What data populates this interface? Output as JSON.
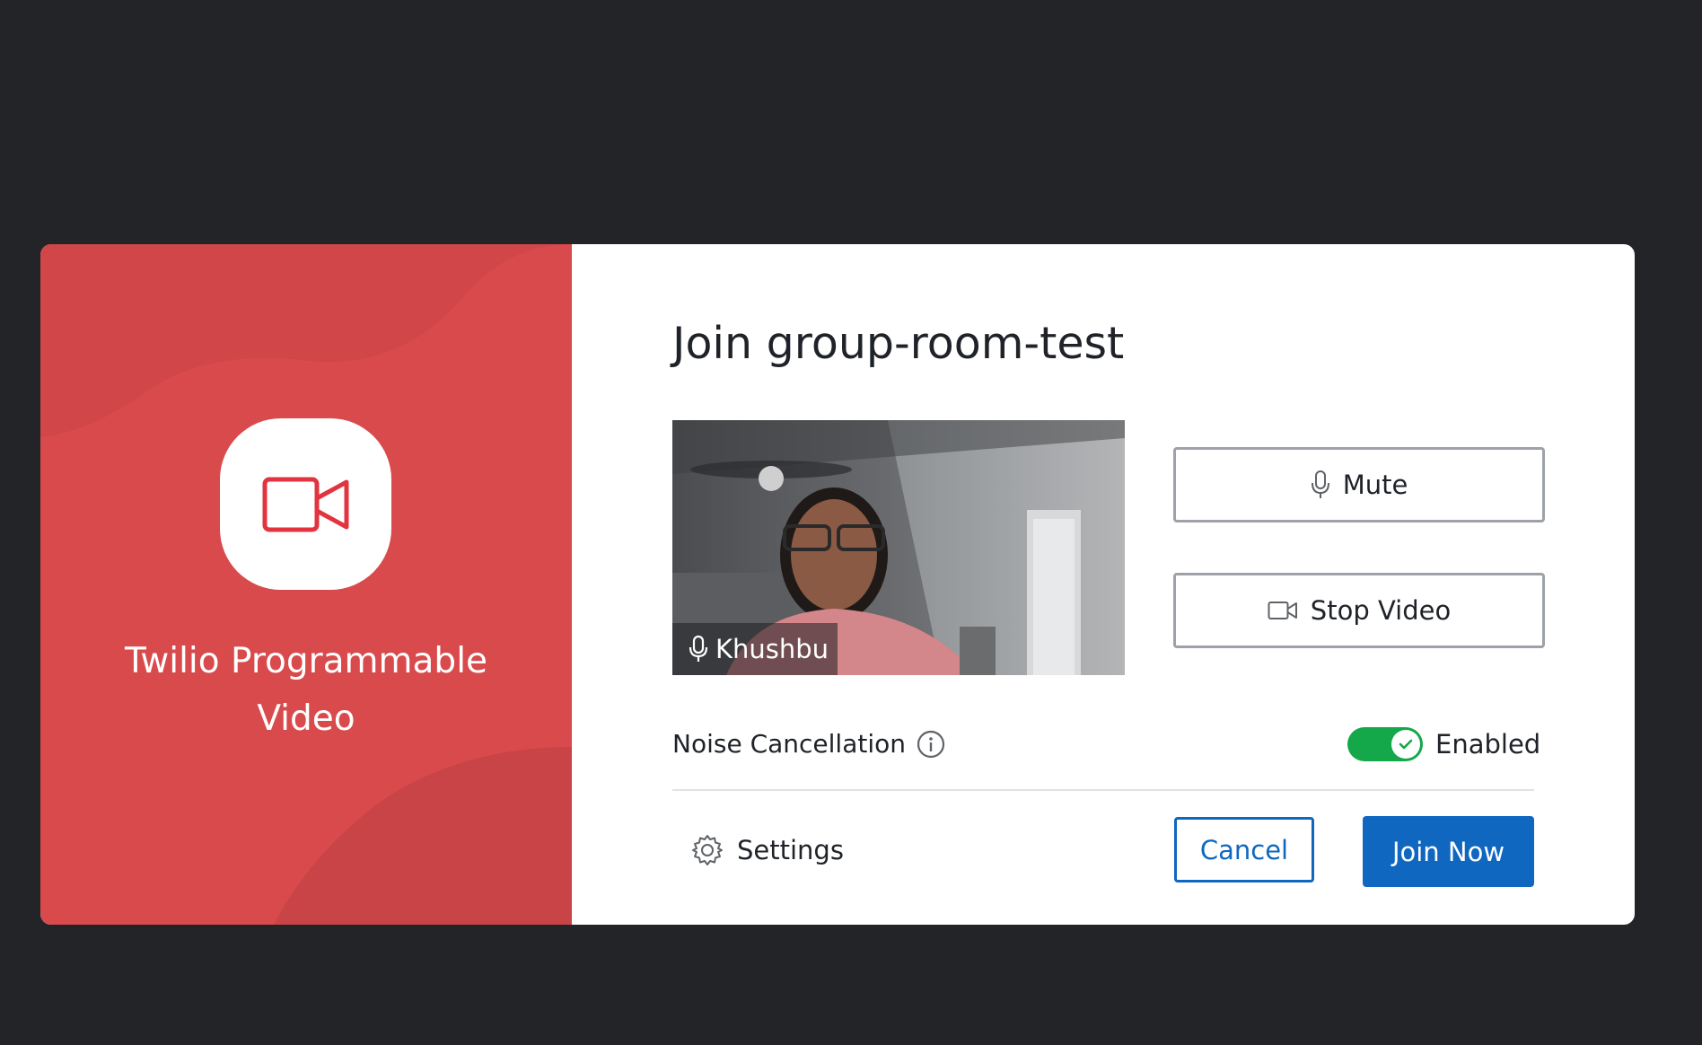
{
  "colors": {
    "page_bg": "#232427",
    "brand_red": "#d94a4c",
    "primary_blue": "#0f67c0",
    "toggle_green": "#14a84a"
  },
  "brand": {
    "icon": "video-camera-icon",
    "title": "Twilio Programmable Video"
  },
  "dialog": {
    "title": "Join group-room-test"
  },
  "preview": {
    "participant_name": "Khushbu",
    "mic_icon": "microphone-icon"
  },
  "controls": {
    "mute_label": "Mute",
    "mute_icon": "microphone-icon",
    "stop_video_label": "Stop Video",
    "stop_video_icon": "video-camera-icon"
  },
  "noise_cancellation": {
    "label": "Noise Cancellation",
    "info_icon": "info-icon",
    "status": "Enabled",
    "enabled": true
  },
  "footer": {
    "settings_label": "Settings",
    "settings_icon": "gear-icon",
    "cancel_label": "Cancel",
    "join_label": "Join Now"
  }
}
